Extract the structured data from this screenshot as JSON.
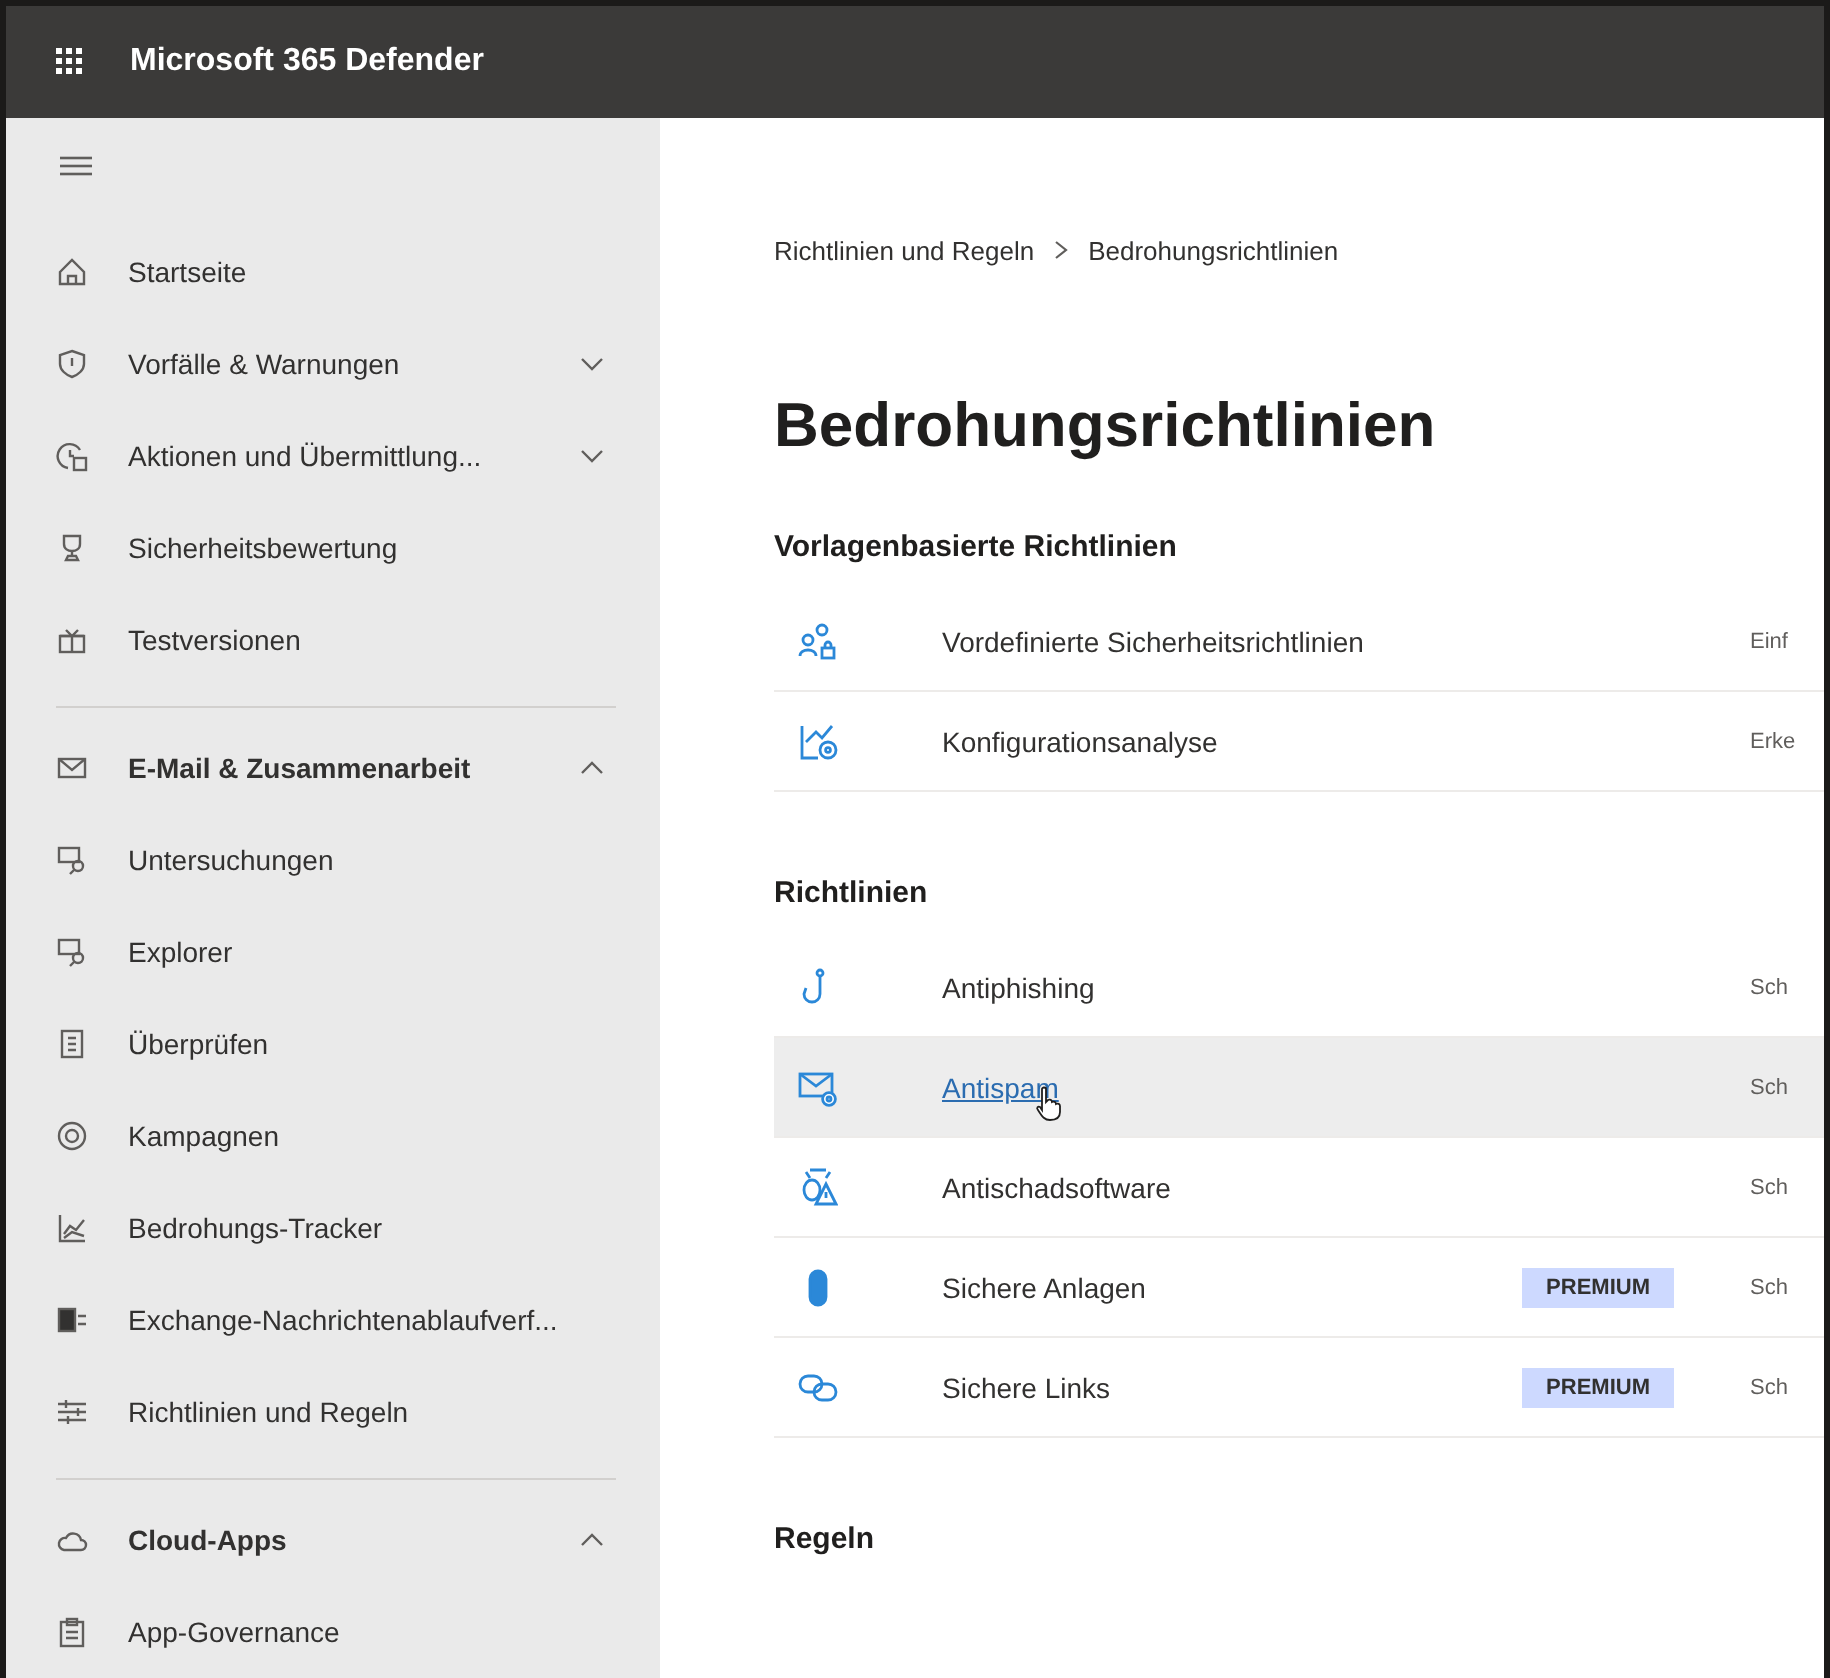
{
  "header": {
    "title": "Microsoft 365 Defender"
  },
  "sidebar": {
    "sections": [
      {
        "items": [
          {
            "kind": "item",
            "label": "Startseite"
          },
          {
            "kind": "item",
            "label": "Vorfälle & Warnungen",
            "expanded": false
          },
          {
            "kind": "item",
            "label": "Aktionen und Übermittlung...",
            "expanded": false
          },
          {
            "kind": "item",
            "label": "Sicherheitsbewertung"
          },
          {
            "kind": "item",
            "label": "Testversionen"
          }
        ]
      },
      {
        "items": [
          {
            "kind": "group",
            "label": "E-Mail & Zusammenarbeit",
            "expanded": true
          },
          {
            "kind": "item",
            "label": "Untersuchungen"
          },
          {
            "kind": "item",
            "label": "Explorer"
          },
          {
            "kind": "item",
            "label": "Überprüfen"
          },
          {
            "kind": "item",
            "label": "Kampagnen"
          },
          {
            "kind": "item",
            "label": "Bedrohungs-Tracker"
          },
          {
            "kind": "item",
            "label": "Exchange-Nachrichtenablaufverf..."
          },
          {
            "kind": "item",
            "label": "Richtlinien und Regeln"
          }
        ]
      },
      {
        "items": [
          {
            "kind": "group",
            "label": "Cloud-Apps",
            "expanded": true
          },
          {
            "kind": "item",
            "label": "App-Governance"
          }
        ]
      }
    ]
  },
  "breadcrumb": [
    "Richtlinien und Regeln",
    "Bedrohungsrichtlinien"
  ],
  "page_title": "Bedrohungsrichtlinien",
  "sections": [
    {
      "heading": "Vorlagenbasierte Richtlinien",
      "rows": [
        {
          "name": "Vordefinierte Sicherheitsrichtlinien",
          "description": "Einf",
          "hovered": false
        },
        {
          "name": "Konfigurationsanalyse",
          "description": "Erke",
          "hovered": false
        }
      ]
    },
    {
      "heading": "Richtlinien",
      "rows": [
        {
          "name": "Antiphishing",
          "description": "Sch",
          "hovered": false
        },
        {
          "name": "Antispam",
          "description": "Sch",
          "hovered": true
        },
        {
          "name": "Antischadsoftware",
          "description": "Sch",
          "hovered": false
        },
        {
          "name": "Sichere Anlagen",
          "badge": "PREMIUM",
          "description": "Sch",
          "hovered": false
        },
        {
          "name": "Sichere Links",
          "badge": "PREMIUM",
          "description": "Sch",
          "hovered": false
        }
      ]
    },
    {
      "heading": "Regeln"
    }
  ]
}
